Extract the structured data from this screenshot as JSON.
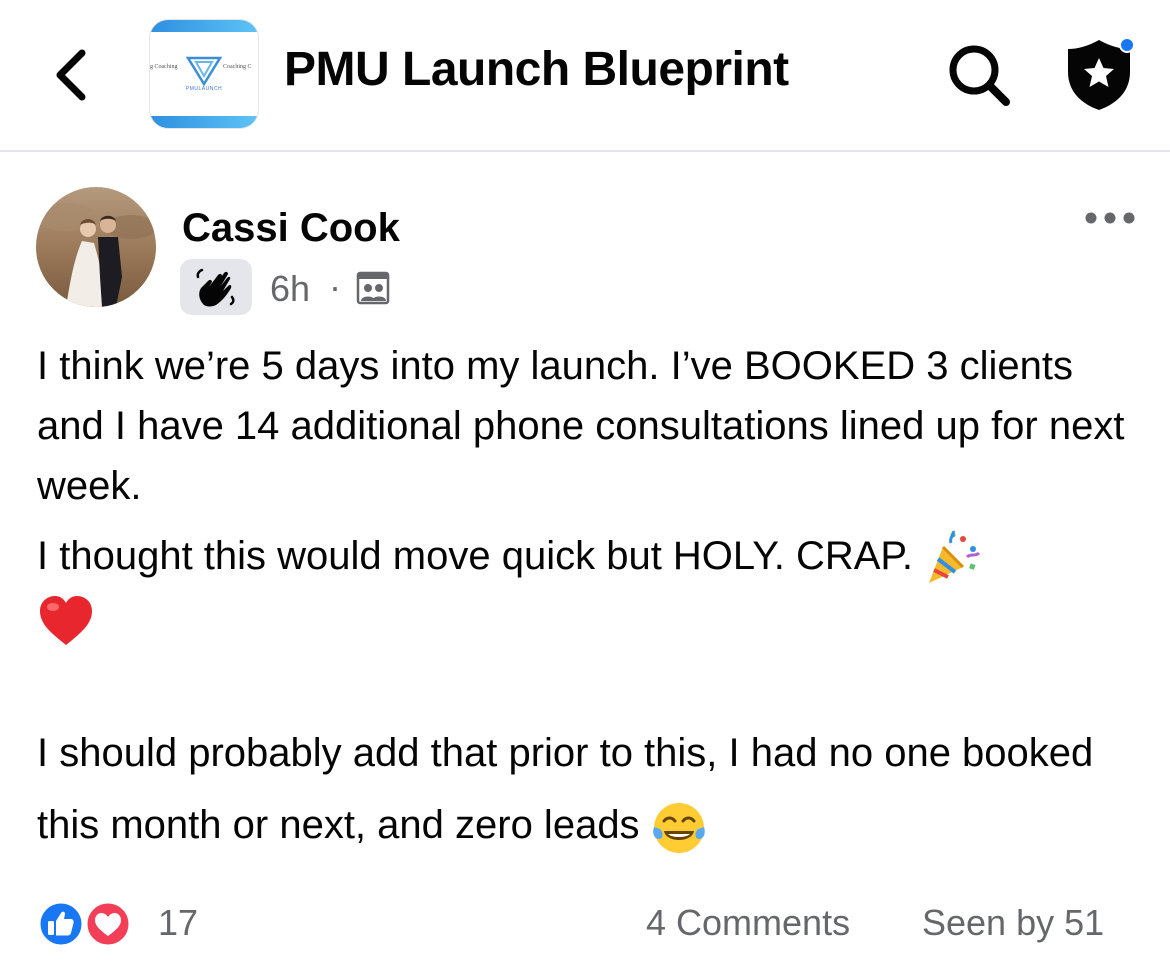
{
  "header": {
    "title": "PMU Launch Blueprint",
    "logo": {
      "left_text": "g Coaching",
      "right_text": "Coaching C",
      "sub_text": "PMULAUNCH"
    },
    "icons": {
      "back": "chevron-left-icon",
      "search": "search-icon",
      "admin": "shield-star-icon"
    },
    "notification_dot_color": "#1877f2"
  },
  "post": {
    "author": "Cassi Cook",
    "badge_icon": "wave-hand-icon",
    "time": "6h",
    "separator": "·",
    "privacy_icon": "group-members-icon",
    "body": {
      "line1": "I think we’re 5 days into my launch. I’ve BOOKED 3 clients and I have 14 additional phone consultations lined up for next week.",
      "line2": "I thought this would move quick but HOLY. CRAP.",
      "line2_emoji": "party-popper-icon",
      "heart_emoji": "red-heart-icon",
      "line3": "I should probably add that prior to this, I had no one booked this month or next, and zero leads",
      "line3_emoji": "tears-of-joy-icon"
    },
    "footer": {
      "reaction_icons": [
        "like-icon",
        "love-icon"
      ],
      "reaction_count": "17",
      "comments": "4 Comments",
      "seen_by": "Seen by 51"
    }
  },
  "colors": {
    "text_primary": "#050505",
    "text_secondary": "#65676b",
    "like_blue": "#1877f2",
    "love_red": "#f33e58",
    "divider": "#e4e6eb"
  }
}
